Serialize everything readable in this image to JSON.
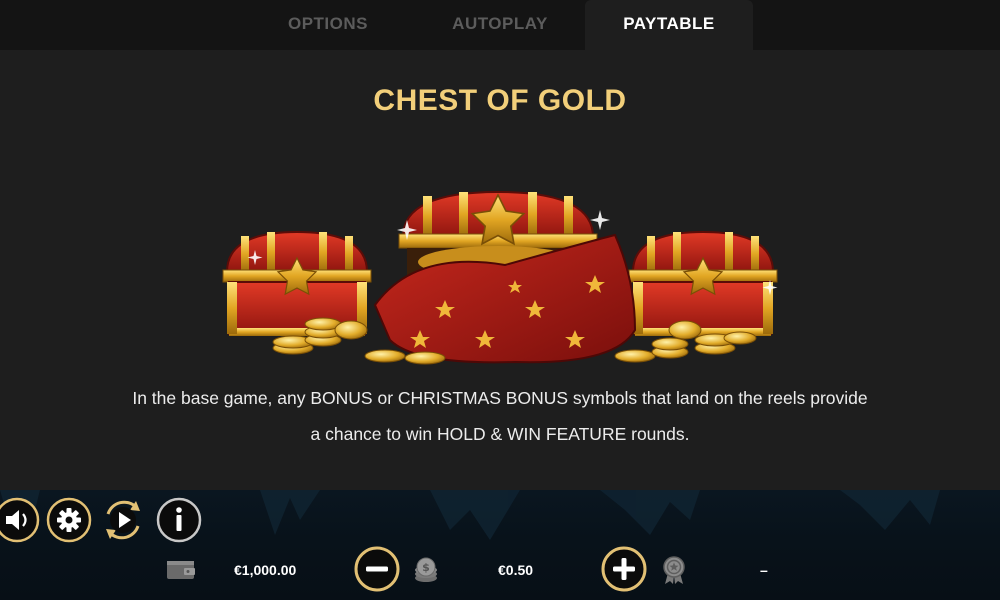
{
  "tabs": [
    {
      "label": "OPTIONS",
      "active": false
    },
    {
      "label": "AUTOPLAY",
      "active": false
    },
    {
      "label": "PAYTABLE",
      "active": true
    }
  ],
  "paytable": {
    "title": "CHEST OF GOLD",
    "description": "In the base game, any BONUS or CHRISTMAS BONUS symbols that land on the reels provide a chance to win HOLD & WIN FEATURE rounds."
  },
  "controls": {
    "icons": [
      "sound-icon",
      "settings-icon",
      "autoplay-icon",
      "info-icon",
      "wallet-icon",
      "minus-icon",
      "coin-stack-icon",
      "plus-icon",
      "award-icon"
    ],
    "balance": "€1,000.00",
    "bet": "€0.50",
    "win": "–"
  },
  "colors": {
    "accent_gold": "#f2cf7a",
    "background": "#1e1e1e",
    "tabbar": "#141414",
    "bottom_bar": "#08121a"
  }
}
